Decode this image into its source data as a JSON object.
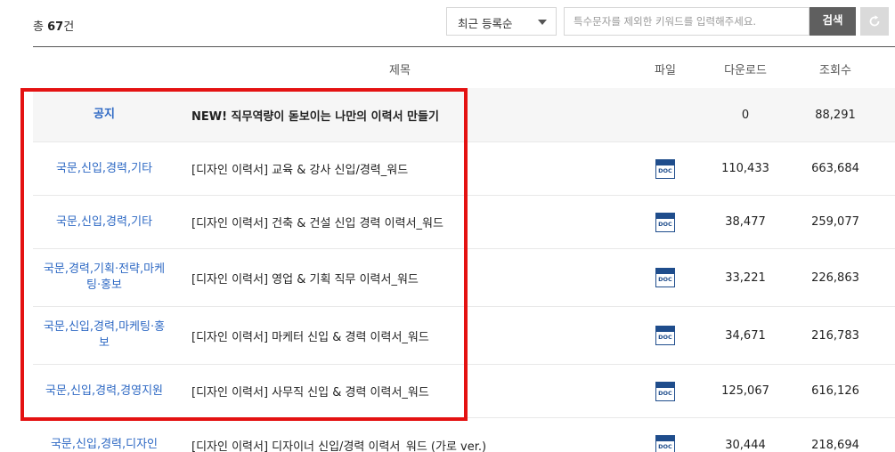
{
  "summary": {
    "prefix": "총",
    "count": "67",
    "suffix": "건"
  },
  "controls": {
    "sort_value": "최근 등록순",
    "search_placeholder": "특수문자를 제외한 키워드를 입력해주세요.",
    "search_label": "검색",
    "reset_icon": "refresh-icon"
  },
  "table": {
    "headers": {
      "title": "제목",
      "file": "파일",
      "downloads": "다운로드",
      "views": "조회수"
    },
    "rows": [
      {
        "category": "공지",
        "title": "NEW! 직무역량이 돋보이는 나만의 이력서 만들기",
        "file": "",
        "downloads": "0",
        "views": "88,291",
        "notice": true
      },
      {
        "category": "국문,신입,경력,기타",
        "title": "[디자인 이력서] 교육 & 강사 신입/경력_워드",
        "file": "DOC",
        "downloads": "110,433",
        "views": "663,684"
      },
      {
        "category": "국문,신입,경력,기타",
        "title": "[디자인 이력서] 건축 & 건설 신입 경력 이력서_워드",
        "file": "DOC",
        "downloads": "38,477",
        "views": "259,077"
      },
      {
        "category": "국문,경력,기획·전략,마케팅·홍보",
        "title": "[디자인 이력서] 영업 & 기획 직무 이력서_워드",
        "file": "DOC",
        "downloads": "33,221",
        "views": "226,863"
      },
      {
        "category": "국문,신입,경력,마케팅·홍보",
        "title": "[디자인 이력서] 마케터 신입 & 경력 이력서_워드",
        "file": "DOC",
        "downloads": "34,671",
        "views": "216,783"
      },
      {
        "category": "국문,신입,경력,경영지원",
        "title": "[디자인 이력서] 사무직 신입 & 경력 이력서_워드",
        "file": "DOC",
        "downloads": "125,067",
        "views": "616,126"
      },
      {
        "category": "국문,신입,경력,디자인",
        "title": "[디자인 이력서] 디자이너 신입/경력 이력서_워드 (가로 ver.)",
        "file": "DOC",
        "downloads": "30,444",
        "views": "218,694"
      }
    ]
  },
  "colors": {
    "category_link": "#2e69c4",
    "highlight_border": "#e41212",
    "search_button": "#5f5f5f",
    "doc_icon": "#1f4d8c"
  }
}
